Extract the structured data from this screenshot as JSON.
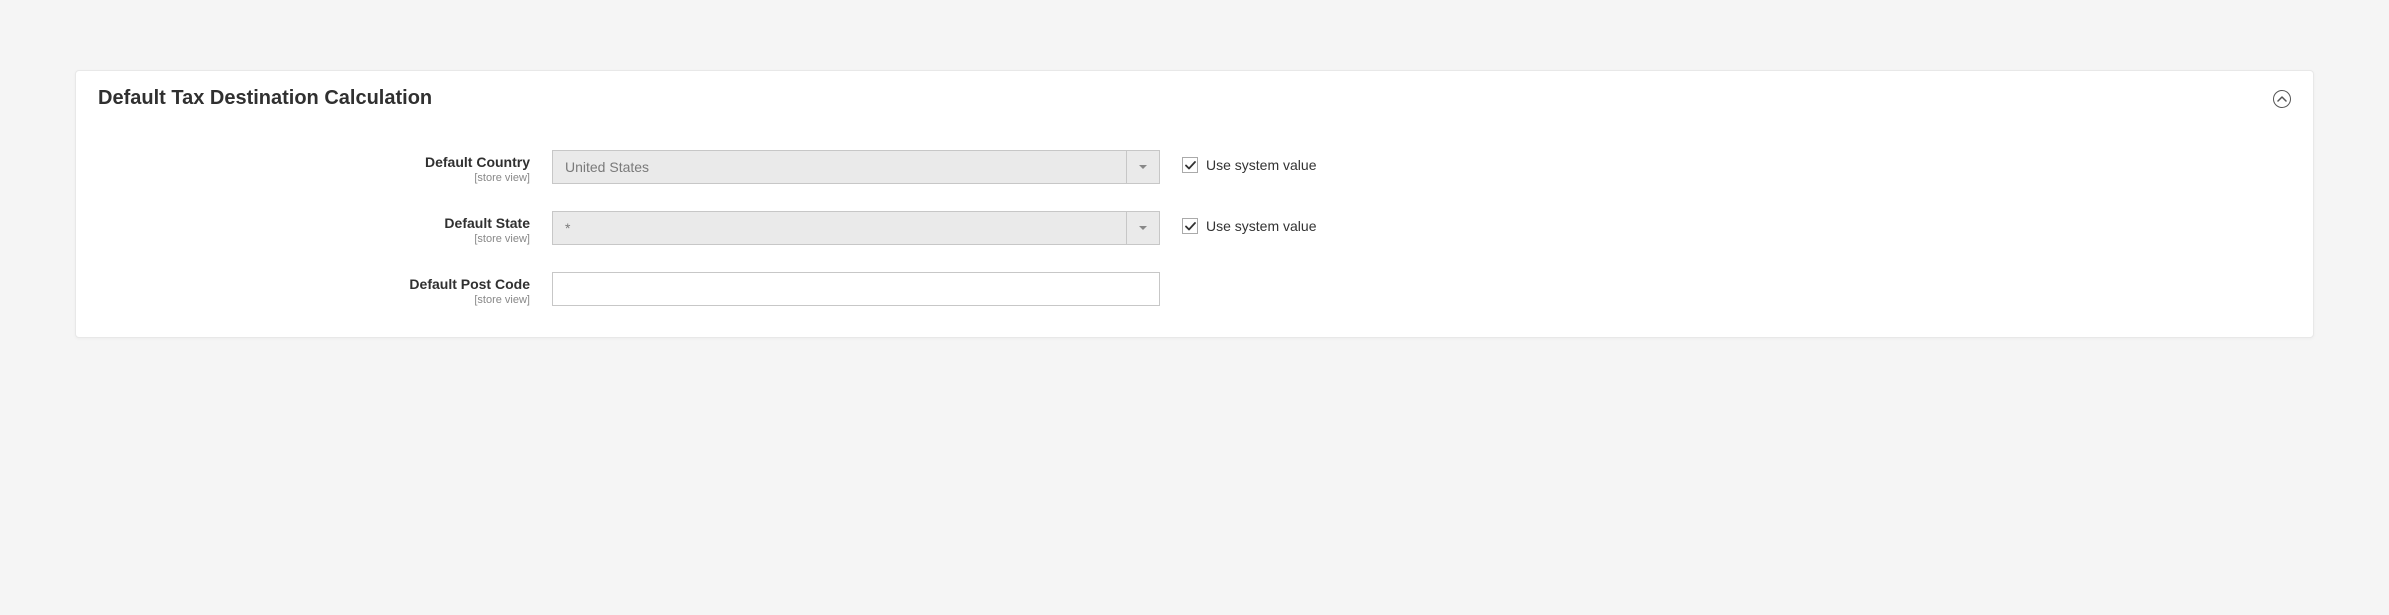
{
  "panel": {
    "title": "Default Tax Destination Calculation"
  },
  "fields": {
    "country": {
      "label": "Default Country",
      "scope": "[store view]",
      "value": "United States",
      "useSystemLabel": "Use system value"
    },
    "state": {
      "label": "Default State",
      "scope": "[store view]",
      "value": "*",
      "useSystemLabel": "Use system value"
    },
    "postcode": {
      "label": "Default Post Code",
      "scope": "[store view]",
      "value": ""
    }
  }
}
